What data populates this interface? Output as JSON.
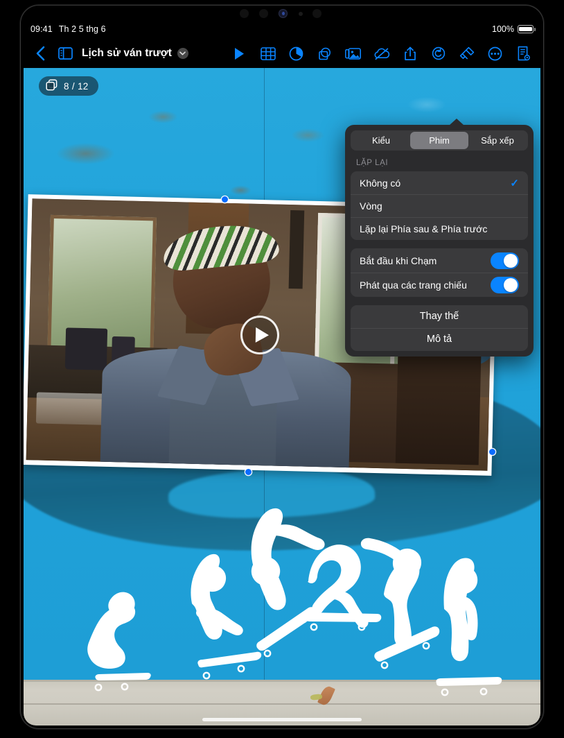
{
  "status_bar": {
    "time": "09:41",
    "date": "Th 2 5 thg 6",
    "battery_percent": "100%"
  },
  "toolbar": {
    "back_icon": "chevron-left-icon",
    "sidebar_icon": "sidebar-icon",
    "document_title": "Lịch sử ván trượt",
    "title_chevron_icon": "chevron-down-icon",
    "items": [
      {
        "name": "play-icon",
        "label": "Phát"
      },
      {
        "name": "table-icon",
        "label": "Bảng"
      },
      {
        "name": "chart-icon",
        "label": "Biểu đồ"
      },
      {
        "name": "shape-icon",
        "label": "Hình"
      },
      {
        "name": "media-icon",
        "label": "Phương tiện"
      },
      {
        "name": "cloud-off-icon",
        "label": "Cộng tác"
      },
      {
        "name": "share-icon",
        "label": "Chia sẻ"
      },
      {
        "name": "undo-icon",
        "label": "Hoàn tác"
      },
      {
        "name": "format-brush-icon",
        "label": "Định dạng"
      },
      {
        "name": "more-icon",
        "label": "Thêm"
      },
      {
        "name": "document-options-icon",
        "label": "Tùy chọn tài liệu"
      }
    ],
    "active_item": "format-brush-icon"
  },
  "slide_badge": {
    "icon": "slides-icon",
    "text": "8 / 12"
  },
  "canvas": {
    "video_play_icon": "play-circle-icon",
    "selection_handles": 4
  },
  "popover": {
    "arrow_icon": "popover-arrow",
    "segments": [
      {
        "label": "Kiểu",
        "selected": false
      },
      {
        "label": "Phim",
        "selected": true
      },
      {
        "label": "Sắp xếp",
        "selected": false
      }
    ],
    "section_label": "LẶP LẠI",
    "repeat_options": [
      {
        "label": "Không có",
        "checked": true
      },
      {
        "label": "Vòng",
        "checked": false
      },
      {
        "label": "Lặp lại Phía sau & Phía trước",
        "checked": false
      }
    ],
    "checkmark": "✓",
    "switches": [
      {
        "label": "Bắt đầu khi Chạm",
        "on": true
      },
      {
        "label": "Phát qua các trang chiếu",
        "on": true
      }
    ],
    "actions": [
      {
        "label": "Thay thế"
      },
      {
        "label": "Mô tả"
      }
    ]
  },
  "colors": {
    "accent": "#0a84ff",
    "popover_bg": "#2b2b2d",
    "group_bg": "#3a3a3c",
    "wall_blue": "#21a3da",
    "wave_blue": "#15607f"
  }
}
